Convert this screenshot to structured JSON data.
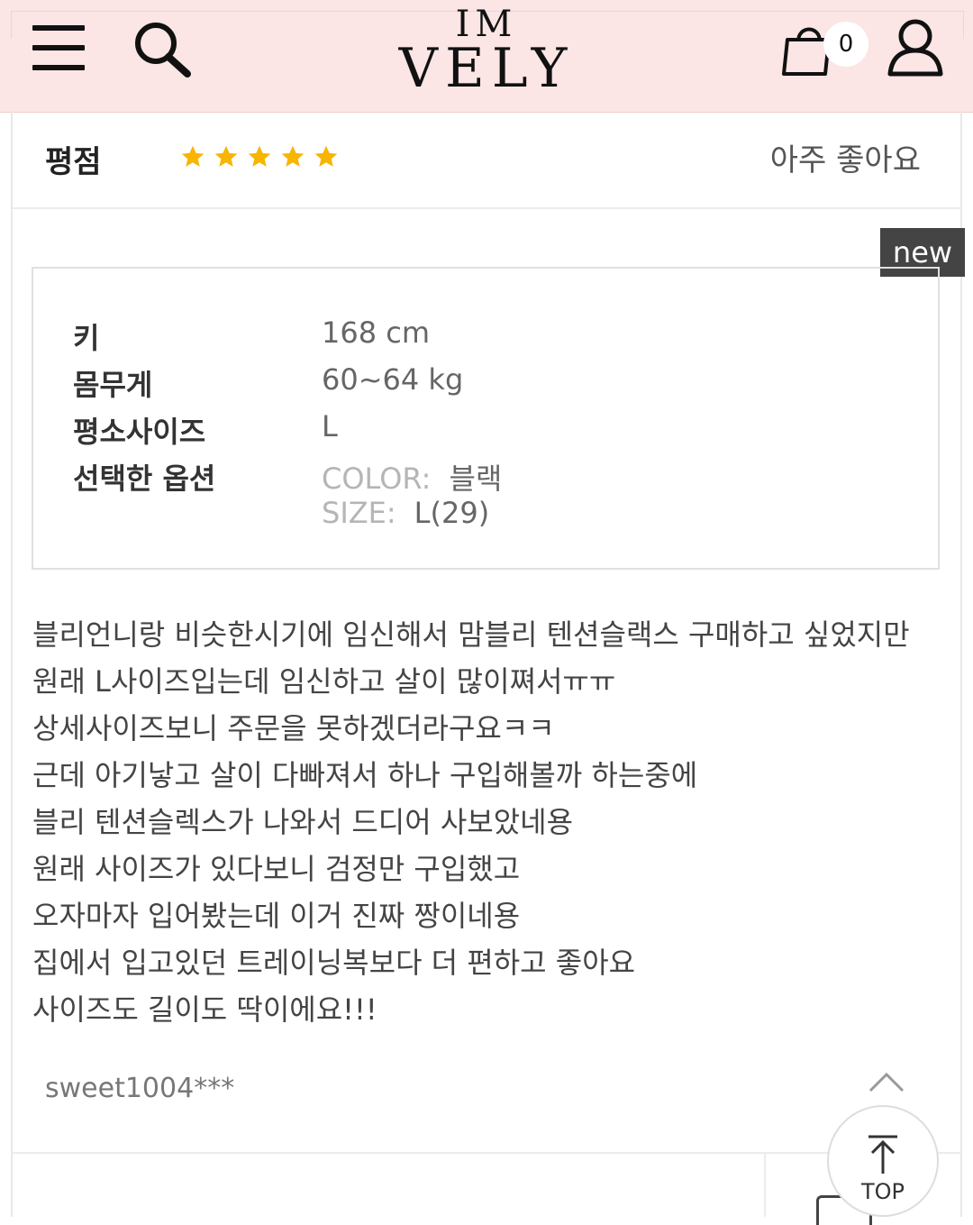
{
  "header": {
    "logo_line1": "IM",
    "logo_line2": "VELY",
    "cart_count": "0",
    "icons": [
      "menu-icon",
      "search-icon",
      "cart-icon",
      "user-icon"
    ]
  },
  "rating": {
    "label": "평점",
    "stars": 5,
    "star_color": "#f7b500",
    "text": "아주 좋아요"
  },
  "new_badge": "new",
  "info": {
    "height_label": "키",
    "height_value": "168 cm",
    "weight_label": "몸무게",
    "weight_value": "60~64 kg",
    "size_label": "평소사이즈",
    "size_value": "L",
    "option_label": "선택한 옵션",
    "color_key": "COLOR:",
    "color_value": "블랙",
    "size_key": "SIZE:",
    "size_option_value": "L(29)"
  },
  "review_lines": [
    "블리언니랑 비슷한시기에 임신해서 맘블리 텐션슬랙스 구매하고 싶었지만",
    "원래 L사이즈입는데 임신하고 살이 많이쪄서ㅠㅠ",
    "상세사이즈보니 주문을 못하겠더라구요ㅋㅋ",
    "근데 아기낳고 살이 다빠져서 하나 구입해볼까 하는중에",
    "블리 텐션슬렉스가 나와서 드디어 사보았네용",
    "원래 사이즈가 있다보니 검정만 구입했고",
    "오자마자 입어봤는데 이거 진짜 짱이네용",
    "집에서 입고있던 트레이닝복보다 더 편하고 좋아요",
    "사이즈도 길이도 딱이에요!!!"
  ],
  "author": "sweet1004***",
  "top_button_label": "TOP",
  "colors": {
    "header_bg": "#fbe5e5",
    "badge_bg": "#444444"
  }
}
